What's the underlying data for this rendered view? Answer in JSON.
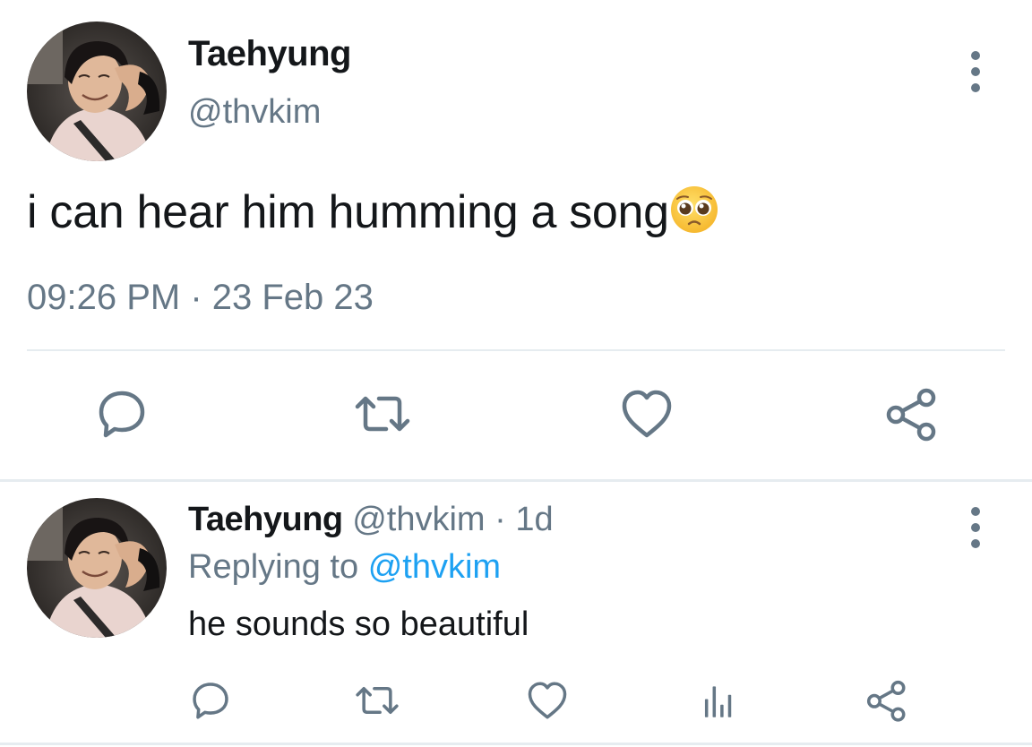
{
  "main_tweet": {
    "display_name": "Taehyung",
    "handle": "@thvkim",
    "text": "i can hear him humming a song",
    "emoji_icon": "pleading-face-emoji",
    "timestamp": "09:26 PM · 23 Feb 23",
    "actions": [
      "reply-icon",
      "retweet-icon",
      "like-icon",
      "share-icon"
    ]
  },
  "reply_tweet": {
    "display_name": "Taehyung",
    "handle": "@thvkim",
    "separator": "·",
    "time": "1d",
    "replying_prefix": "Replying to",
    "replying_to": "@thvkim",
    "text": "he sounds so beautiful",
    "actions": [
      "reply-icon",
      "retweet-icon",
      "like-icon",
      "analytics-icon",
      "share-icon"
    ]
  },
  "colors": {
    "text_primary": "#14171a",
    "text_secondary": "#657786",
    "link": "#1da1f2",
    "divider": "#e6ecf0"
  }
}
